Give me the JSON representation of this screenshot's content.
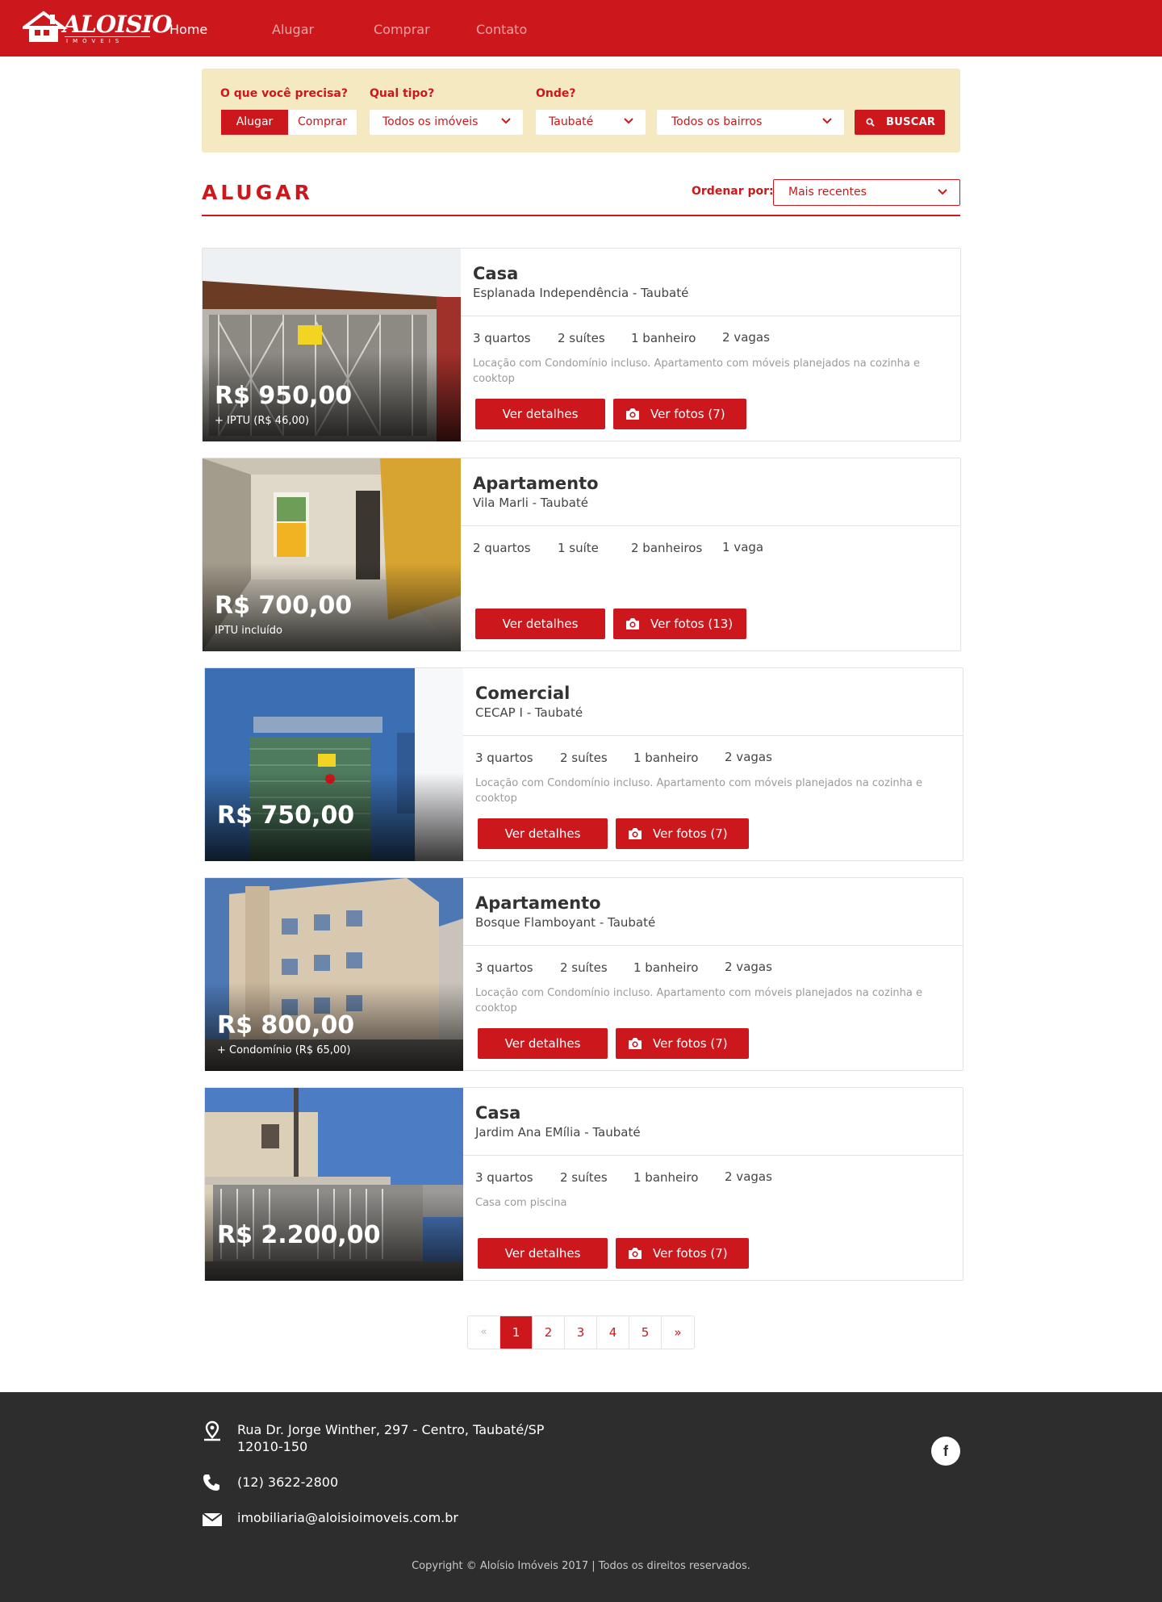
{
  "colors": {
    "brand": "#cc181c",
    "search_bg": "#f5e9c2",
    "footer_bg": "#2d2d2d"
  },
  "brand": {
    "logo_text": "ALOISIO",
    "logo_sub": "IMÓVEIS"
  },
  "nav": [
    "Home",
    "Alugar",
    "Comprar",
    "Contato"
  ],
  "search": {
    "label_need": "O que você precisa?",
    "label_type": "Qual tipo?",
    "label_where": "Onde?",
    "opt_rent": "Alugar",
    "opt_buy": "Comprar",
    "type_value": "Todos os imóveis",
    "city_value": "Taubaté",
    "district_value": "Todos os bairros",
    "button": "BUSCAR"
  },
  "section": {
    "title": "ALUGAR",
    "order_label": "Ordenar por:",
    "order_value": "Mais recentes"
  },
  "listings": [
    {
      "price": "R$ 950,00",
      "price_note": "+ IPTU (R$ 46,00)",
      "type": "Casa",
      "location": "Esplanada Independência - Taubaté",
      "features": [
        "3 quartos",
        "2 suítes",
        "1 banheiro",
        "2 vagas"
      ],
      "description": "Locação com Condomínio incluso. Apartamento com móveis planejados na cozinha e cooktop",
      "details": "Ver detalhes",
      "photos": "Ver fotos (7)"
    },
    {
      "price": "R$ 700,00",
      "price_note": "IPTU incluído",
      "type": "Apartamento",
      "location": "Vila Marli - Taubaté",
      "features": [
        "2 quartos",
        "1 suíte",
        "2 banheiros",
        "1 vaga"
      ],
      "description": "",
      "details": "Ver detalhes",
      "photos": "Ver fotos (13)"
    },
    {
      "price": "R$ 750,00",
      "price_note": "",
      "type": "Comercial",
      "location": "CECAP I - Taubaté",
      "features": [
        "3 quartos",
        "2 suítes",
        "1 banheiro",
        "2 vagas"
      ],
      "description": "Locação com Condomínio incluso. Apartamento com móveis planejados na cozinha e cooktop",
      "details": "Ver detalhes",
      "photos": "Ver fotos (7)"
    },
    {
      "price": "R$ 800,00",
      "price_note": "+ Condomínio (R$ 65,00)",
      "type": "Apartamento",
      "location": "Bosque Flamboyant - Taubaté",
      "features": [
        "3 quartos",
        "2 suítes",
        "1 banheiro",
        "2 vagas"
      ],
      "description": "Locação com Condomínio incluso. Apartamento com móveis planejados na cozinha e cooktop",
      "details": "Ver detalhes",
      "photos": "Ver fotos (7)"
    },
    {
      "price": "R$ 2.200,00",
      "price_note": "",
      "type": "Casa",
      "location": "Jardim Ana EMília - Taubaté",
      "features": [
        "3 quartos",
        "2 suítes",
        "1 banheiro",
        "2 vagas"
      ],
      "description": "Casa com piscina",
      "details": "Ver detalhes",
      "photos": "Ver fotos (7)"
    }
  ],
  "pagination": {
    "prev": "«",
    "pages": [
      "1",
      "2",
      "3",
      "4",
      "5"
    ],
    "next": "»",
    "current": "1"
  },
  "footer": {
    "address_line1": "Rua Dr. Jorge Winther, 297 - Centro, Taubaté/SP",
    "address_line2": "12010-150",
    "phone": "(12) 3622-2800",
    "email": "imobiliaria@aloisioimoveis.com.br",
    "facebook": "f",
    "copyright": "Copyright © Aloísio Imóveis 2017 | Todos os direitos reservados."
  }
}
